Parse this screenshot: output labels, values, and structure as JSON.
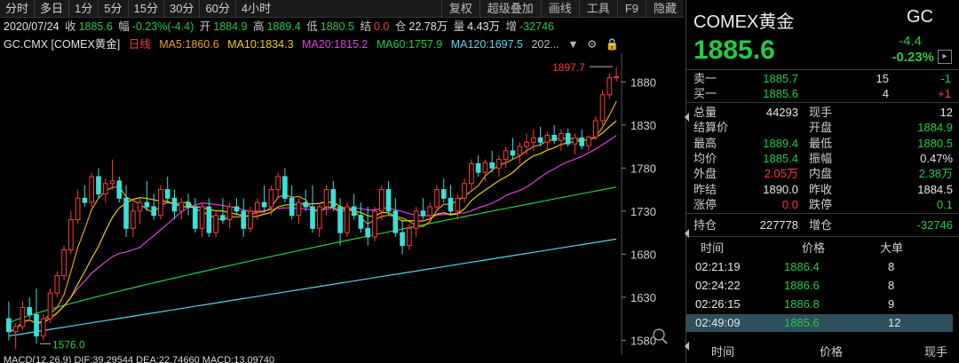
{
  "period_tabs": [
    "分时",
    "多日",
    "1分",
    "5分",
    "15分",
    "30分",
    "60分",
    "4小时"
  ],
  "tool_tabs": [
    "复权",
    "超级叠加",
    "画线",
    "工具",
    "F9",
    "隐藏"
  ],
  "quote": {
    "date": "2020/07/24",
    "close_label": "收",
    "close": "1885.6",
    "range_label": "幅",
    "range": "-0.23%(-4.4)",
    "open_label": "开",
    "open": "1884.9",
    "high_label": "高",
    "high": "1889.4",
    "low_label": "低",
    "low": "1880.5",
    "settle_label": "结",
    "settle": "0.0",
    "oi_label": "仓",
    "oi": "22.78万",
    "vol_label": "量",
    "vol": "4.43万",
    "inc_label": "增",
    "inc": "-32746"
  },
  "ma_line": {
    "symbol": "GC.CMX [COMEX黄金]",
    "period": "日线",
    "ma5": "MA5:1860.6",
    "ma10": "MA10:1834.3",
    "ma20": "MA20:1815.2",
    "ma60": "MA60:1757.9",
    "ma120": "MA120:1697.5",
    "more": "202..."
  },
  "macd_line": "MACD(12,26,9)  DIF:39.29544  DEA:22.74660  MACD:13.09740",
  "colors": {
    "up": "#ff3b3b",
    "down": "#22cc44",
    "ma5": "#e8e8e8",
    "ma10": "#f0d000",
    "ma20": "#e040e0",
    "ma60": "#22cc44",
    "ma120": "#55d8e8",
    "bear_candle": "#3ae0d8",
    "bull_candle": "#ff3b3b"
  },
  "chart_data": {
    "type": "candlestick",
    "y_axis_ticks": [
      1880,
      1830,
      1780,
      1730,
      1680,
      1630,
      1580
    ],
    "ylim": [
      1565,
      1905
    ],
    "annotations": [
      {
        "label": "1897.7",
        "kind": "high",
        "value": 1897.7
      },
      {
        "label": "1576.0",
        "kind": "low",
        "value": 1576.0
      }
    ],
    "candles": [
      [
        1605,
        1625,
        1580,
        1590
      ],
      [
        1590,
        1600,
        1570,
        1596
      ],
      [
        1596,
        1625,
        1592,
        1618
      ],
      [
        1618,
        1630,
        1605,
        1610
      ],
      [
        1610,
        1640,
        1576,
        1585
      ],
      [
        1585,
        1610,
        1580,
        1605
      ],
      [
        1605,
        1640,
        1600,
        1635
      ],
      [
        1635,
        1660,
        1630,
        1655
      ],
      [
        1655,
        1690,
        1650,
        1685
      ],
      [
        1685,
        1730,
        1680,
        1720
      ],
      [
        1720,
        1755,
        1715,
        1745
      ],
      [
        1745,
        1760,
        1735,
        1740
      ],
      [
        1740,
        1775,
        1735,
        1770
      ],
      [
        1770,
        1780,
        1745,
        1750
      ],
      [
        1750,
        1768,
        1740,
        1762
      ],
      [
        1762,
        1790,
        1755,
        1765
      ],
      [
        1765,
        1770,
        1740,
        1745
      ],
      [
        1745,
        1760,
        1700,
        1710
      ],
      [
        1710,
        1740,
        1700,
        1730
      ],
      [
        1730,
        1745,
        1715,
        1740
      ],
      [
        1740,
        1765,
        1730,
        1735
      ],
      [
        1735,
        1750,
        1720,
        1725
      ],
      [
        1725,
        1760,
        1720,
        1755
      ],
      [
        1755,
        1770,
        1740,
        1745
      ],
      [
        1745,
        1755,
        1720,
        1730
      ],
      [
        1730,
        1745,
        1720,
        1740
      ],
      [
        1740,
        1750,
        1725,
        1735
      ],
      [
        1735,
        1745,
        1705,
        1710
      ],
      [
        1710,
        1740,
        1700,
        1735
      ],
      [
        1735,
        1745,
        1700,
        1705
      ],
      [
        1705,
        1730,
        1700,
        1725
      ],
      [
        1725,
        1745,
        1715,
        1720
      ],
      [
        1720,
        1740,
        1710,
        1735
      ],
      [
        1735,
        1745,
        1725,
        1730
      ],
      [
        1730,
        1745,
        1700,
        1710
      ],
      [
        1710,
        1735,
        1705,
        1730
      ],
      [
        1730,
        1745,
        1720,
        1740
      ],
      [
        1740,
        1760,
        1730,
        1735
      ],
      [
        1735,
        1760,
        1725,
        1755
      ],
      [
        1755,
        1775,
        1745,
        1770
      ],
      [
        1770,
        1780,
        1740,
        1745
      ],
      [
        1745,
        1760,
        1720,
        1725
      ],
      [
        1725,
        1745,
        1715,
        1740
      ],
      [
        1740,
        1755,
        1730,
        1735
      ],
      [
        1735,
        1760,
        1705,
        1710
      ],
      [
        1710,
        1740,
        1700,
        1735
      ],
      [
        1735,
        1760,
        1725,
        1755
      ],
      [
        1755,
        1765,
        1730,
        1735
      ],
      [
        1735,
        1745,
        1690,
        1705
      ],
      [
        1705,
        1740,
        1700,
        1735
      ],
      [
        1735,
        1750,
        1720,
        1725
      ],
      [
        1725,
        1740,
        1705,
        1710
      ],
      [
        1710,
        1735,
        1690,
        1700
      ],
      [
        1700,
        1735,
        1695,
        1730
      ],
      [
        1730,
        1760,
        1720,
        1755
      ],
      [
        1755,
        1765,
        1725,
        1730
      ],
      [
        1730,
        1745,
        1700,
        1705
      ],
      [
        1705,
        1720,
        1680,
        1690
      ],
      [
        1690,
        1715,
        1685,
        1710
      ],
      [
        1710,
        1735,
        1700,
        1730
      ],
      [
        1730,
        1745,
        1720,
        1725
      ],
      [
        1725,
        1740,
        1715,
        1735
      ],
      [
        1735,
        1760,
        1730,
        1755
      ],
      [
        1755,
        1768,
        1740,
        1745
      ],
      [
        1745,
        1760,
        1725,
        1730
      ],
      [
        1730,
        1750,
        1720,
        1745
      ],
      [
        1745,
        1768,
        1740,
        1762
      ],
      [
        1762,
        1790,
        1755,
        1785
      ],
      [
        1785,
        1795,
        1770,
        1775
      ],
      [
        1775,
        1790,
        1765,
        1786
      ],
      [
        1786,
        1800,
        1775,
        1780
      ],
      [
        1780,
        1795,
        1770,
        1790
      ],
      [
        1790,
        1805,
        1780,
        1800
      ],
      [
        1800,
        1815,
        1790,
        1795
      ],
      [
        1795,
        1810,
        1785,
        1805
      ],
      [
        1805,
        1820,
        1795,
        1810
      ],
      [
        1810,
        1825,
        1800,
        1815
      ],
      [
        1815,
        1828,
        1805,
        1810
      ],
      [
        1810,
        1822,
        1800,
        1818
      ],
      [
        1818,
        1830,
        1808,
        1812
      ],
      [
        1812,
        1825,
        1800,
        1820
      ],
      [
        1820,
        1826,
        1805,
        1808
      ],
      [
        1808,
        1820,
        1796,
        1815
      ],
      [
        1815,
        1825,
        1802,
        1806
      ],
      [
        1806,
        1818,
        1800,
        1816
      ],
      [
        1816,
        1840,
        1812,
        1835
      ],
      [
        1835,
        1870,
        1830,
        1865
      ],
      [
        1865,
        1890,
        1860,
        1885
      ],
      [
        1885,
        1897.7,
        1880,
        1886
      ]
    ]
  },
  "right_panel": {
    "name": "COMEX黄金",
    "code": "GC",
    "price": "1885.6",
    "chg_abs": "-4.4",
    "chg_pct": "-0.23%",
    "orderbook": [
      {
        "label": "卖一",
        "price": "1885.7",
        "vol": "15",
        "chg": "-1",
        "chg_dir": "down"
      },
      {
        "label": "买一",
        "price": "1885.6",
        "vol": "4",
        "chg": "+1",
        "chg_dir": "up"
      }
    ],
    "stats": [
      {
        "l1": "总量",
        "v1": "44293",
        "c1": "wht",
        "l2": "现手",
        "v2": "12",
        "c2": "wht"
      },
      {
        "l1": "结算价",
        "v1": "",
        "c1": "wht",
        "l2": "开盘",
        "v2": "1884.9",
        "c2": "down"
      },
      {
        "l1": "最高",
        "v1": "1889.4",
        "c1": "down",
        "l2": "最低",
        "v2": "1880.5",
        "c2": "down"
      },
      {
        "l1": "均价",
        "v1": "1885.4",
        "c1": "down",
        "l2": "振幅",
        "v2": "0.47%",
        "c2": "wht"
      },
      {
        "l1": "外盘",
        "v1": "2.05万",
        "c1": "up",
        "l2": "内盘",
        "v2": "2.38万",
        "c2": "down"
      },
      {
        "l1": "昨结",
        "v1": "1890.0",
        "c1": "wht",
        "l2": "昨收",
        "v2": "1884.5",
        "c2": "wht"
      },
      {
        "l1": "涨停",
        "v1": "0.0",
        "c1": "up",
        "l2": "跌停",
        "v2": "0.1",
        "c2": "down"
      }
    ],
    "oi": {
      "l1": "持仓",
      "v1": "227778",
      "l2": "增仓",
      "v2": "-32746"
    },
    "ticks_header": {
      "time": "时间",
      "price": "价格",
      "big": "大单"
    },
    "ticks": [
      {
        "time": "02:21:19",
        "price": "1886.4",
        "vol": "8"
      },
      {
        "time": "02:24:22",
        "price": "1886.6",
        "vol": "8"
      },
      {
        "time": "02:26:15",
        "price": "1886.8",
        "vol": "9"
      },
      {
        "time": "02:49:09",
        "price": "1885.6",
        "vol": "12"
      }
    ],
    "ticks_footer": {
      "time": "时间",
      "price": "价格",
      "hand": "现手"
    }
  }
}
